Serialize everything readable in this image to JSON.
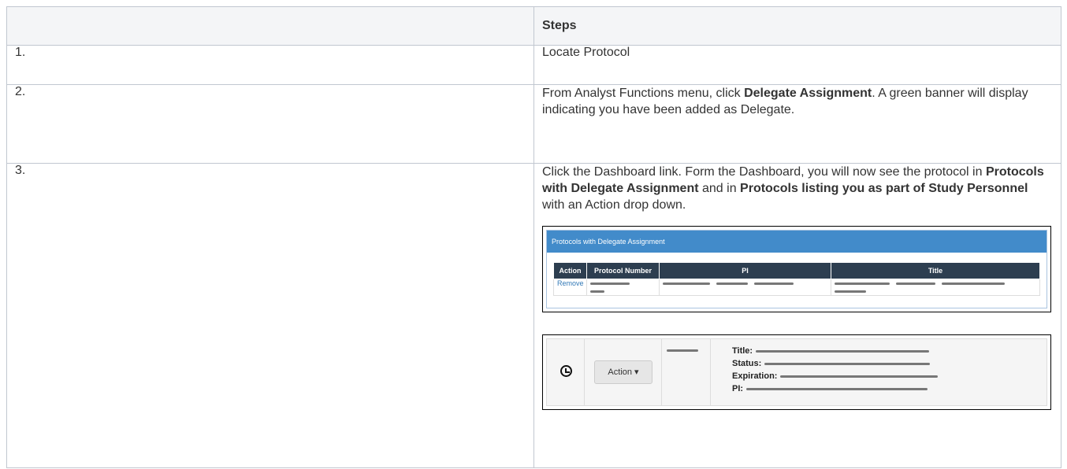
{
  "table": {
    "header": {
      "col1": "",
      "col2": "Steps"
    },
    "rows": [
      {
        "num": "1.",
        "text": "Locate Protocol"
      },
      {
        "num": "2.",
        "text_pre": "From Analyst Functions menu, click ",
        "text_bold": "Delegate Assignment",
        "text_post": ". A green banner will display indicating you have been added as Delegate."
      },
      {
        "num": "3.",
        "text_pre": "Click the Dashboard link. Form the Dashboard, you will now see the protocol in ",
        "bold1": "Protocols with Delegate Assignment",
        "mid": " and in ",
        "bold2": "Protocols listing you as part of Study Personnel",
        "text_post": " with an Action drop down."
      }
    ]
  },
  "screenshot1": {
    "panel_title": "Protocols with Delegate Assignment",
    "columns": [
      "Action",
      "Protocol Number",
      "PI",
      "Title"
    ],
    "row_action": "Remove"
  },
  "screenshot2": {
    "icon": "clock-icon",
    "action_label": "Action ▾",
    "fields": [
      "Title:",
      "Status:",
      "Expiration:",
      "PI:"
    ]
  }
}
